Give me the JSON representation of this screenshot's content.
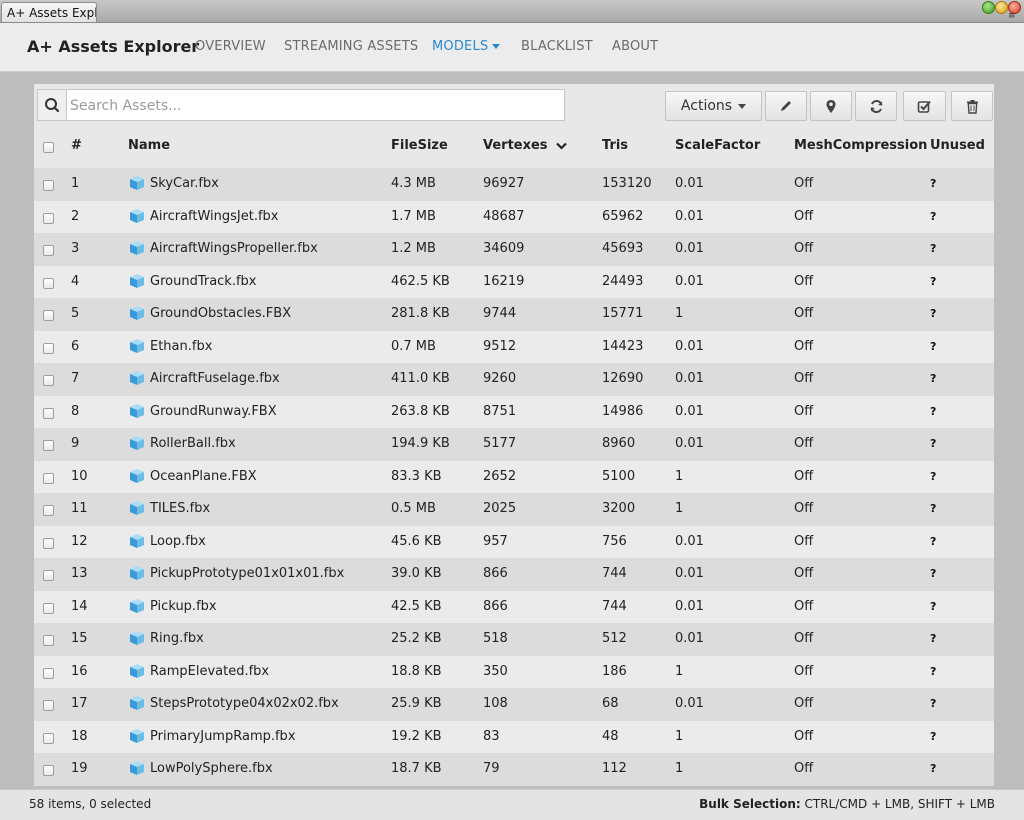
{
  "window": {
    "tab_title": "A+ Assets Explc"
  },
  "navbar": {
    "brand": "A+ Assets Explorer",
    "items": [
      {
        "label": "OVERVIEW",
        "active": false
      },
      {
        "label": "STREAMING ASSETS",
        "active": false
      },
      {
        "label": "MODELS",
        "active": true
      },
      {
        "label": "BLACKLIST",
        "active": false
      },
      {
        "label": "ABOUT",
        "active": false
      }
    ]
  },
  "search": {
    "placeholder": "Search Assets...",
    "value": "",
    "icon": "search-icon"
  },
  "toolbar": {
    "actions_label": "Actions",
    "icons": [
      "pencil-icon",
      "map-marker-icon",
      "refresh-icon",
      "check-square-icon",
      "trash-icon"
    ]
  },
  "table": {
    "columns": {
      "index": "#",
      "name": "Name",
      "filesize": "FileSize",
      "vertexes": "Vertexes",
      "tris": "Tris",
      "scalefactor": "ScaleFactor",
      "meshcompression": "MeshCompression",
      "unused": "Unused"
    },
    "sorted_by": "Vertexes",
    "sort_direction": "descending",
    "rows": [
      {
        "index": "1",
        "name": "SkyCar.fbx",
        "filesize": "4.3 MB",
        "vertexes": "96927",
        "tris": "153120",
        "scalefactor": "0.01",
        "meshcompression": "Off",
        "unused": "?"
      },
      {
        "index": "2",
        "name": "AircraftWingsJet.fbx",
        "filesize": "1.7 MB",
        "vertexes": "48687",
        "tris": "65962",
        "scalefactor": "0.01",
        "meshcompression": "Off",
        "unused": "?"
      },
      {
        "index": "3",
        "name": "AircraftWingsPropeller.fbx",
        "filesize": "1.2 MB",
        "vertexes": "34609",
        "tris": "45693",
        "scalefactor": "0.01",
        "meshcompression": "Off",
        "unused": "?"
      },
      {
        "index": "4",
        "name": "GroundTrack.fbx",
        "filesize": "462.5 KB",
        "vertexes": "16219",
        "tris": "24493",
        "scalefactor": "0.01",
        "meshcompression": "Off",
        "unused": "?"
      },
      {
        "index": "5",
        "name": "GroundObstacles.FBX",
        "filesize": "281.8 KB",
        "vertexes": "9744",
        "tris": "15771",
        "scalefactor": "1",
        "meshcompression": "Off",
        "unused": "?"
      },
      {
        "index": "6",
        "name": "Ethan.fbx",
        "filesize": "0.7 MB",
        "vertexes": "9512",
        "tris": "14423",
        "scalefactor": "0.01",
        "meshcompression": "Off",
        "unused": "?"
      },
      {
        "index": "7",
        "name": "AircraftFuselage.fbx",
        "filesize": "411.0 KB",
        "vertexes": "9260",
        "tris": "12690",
        "scalefactor": "0.01",
        "meshcompression": "Off",
        "unused": "?"
      },
      {
        "index": "8",
        "name": "GroundRunway.FBX",
        "filesize": "263.8 KB",
        "vertexes": "8751",
        "tris": "14986",
        "scalefactor": "0.01",
        "meshcompression": "Off",
        "unused": "?"
      },
      {
        "index": "9",
        "name": "RollerBall.fbx",
        "filesize": "194.9 KB",
        "vertexes": "5177",
        "tris": "8960",
        "scalefactor": "0.01",
        "meshcompression": "Off",
        "unused": "?"
      },
      {
        "index": "10",
        "name": "OceanPlane.FBX",
        "filesize": "83.3 KB",
        "vertexes": "2652",
        "tris": "5100",
        "scalefactor": "1",
        "meshcompression": "Off",
        "unused": "?"
      },
      {
        "index": "11",
        "name": "TILES.fbx",
        "filesize": "0.5 MB",
        "vertexes": "2025",
        "tris": "3200",
        "scalefactor": "1",
        "meshcompression": "Off",
        "unused": "?"
      },
      {
        "index": "12",
        "name": "Loop.fbx",
        "filesize": "45.6 KB",
        "vertexes": "957",
        "tris": "756",
        "scalefactor": "0.01",
        "meshcompression": "Off",
        "unused": "?"
      },
      {
        "index": "13",
        "name": "PickupPrototype01x01x01.fbx",
        "filesize": "39.0 KB",
        "vertexes": "866",
        "tris": "744",
        "scalefactor": "0.01",
        "meshcompression": "Off",
        "unused": "?"
      },
      {
        "index": "14",
        "name": "Pickup.fbx",
        "filesize": "42.5 KB",
        "vertexes": "866",
        "tris": "744",
        "scalefactor": "0.01",
        "meshcompression": "Off",
        "unused": "?"
      },
      {
        "index": "15",
        "name": "Ring.fbx",
        "filesize": "25.2 KB",
        "vertexes": "518",
        "tris": "512",
        "scalefactor": "0.01",
        "meshcompression": "Off",
        "unused": "?"
      },
      {
        "index": "16",
        "name": "RampElevated.fbx",
        "filesize": "18.8 KB",
        "vertexes": "350",
        "tris": "186",
        "scalefactor": "1",
        "meshcompression": "Off",
        "unused": "?"
      },
      {
        "index": "17",
        "name": "StepsPrototype04x02x02.fbx",
        "filesize": "25.9 KB",
        "vertexes": "108",
        "tris": "68",
        "scalefactor": "0.01",
        "meshcompression": "Off",
        "unused": "?"
      },
      {
        "index": "18",
        "name": "PrimaryJumpRamp.fbx",
        "filesize": "19.2 KB",
        "vertexes": "83",
        "tris": "48",
        "scalefactor": "1",
        "meshcompression": "Off",
        "unused": "?"
      },
      {
        "index": "19",
        "name": "LowPolySphere.fbx",
        "filesize": "18.7 KB",
        "vertexes": "79",
        "tris": "112",
        "scalefactor": "1",
        "meshcompression": "Off",
        "unused": "?"
      }
    ]
  },
  "footer": {
    "status": "58 items, 0 selected",
    "bulk_label": "Bulk Selection:",
    "bulk_text": "CTRL/CMD + LMB, SHIFT + LMB"
  },
  "colors": {
    "accent": "#2a8ad0",
    "row_odd": "#dcdcdc",
    "row_even": "#ebebeb",
    "cube_icon": "#3a9ad9"
  }
}
